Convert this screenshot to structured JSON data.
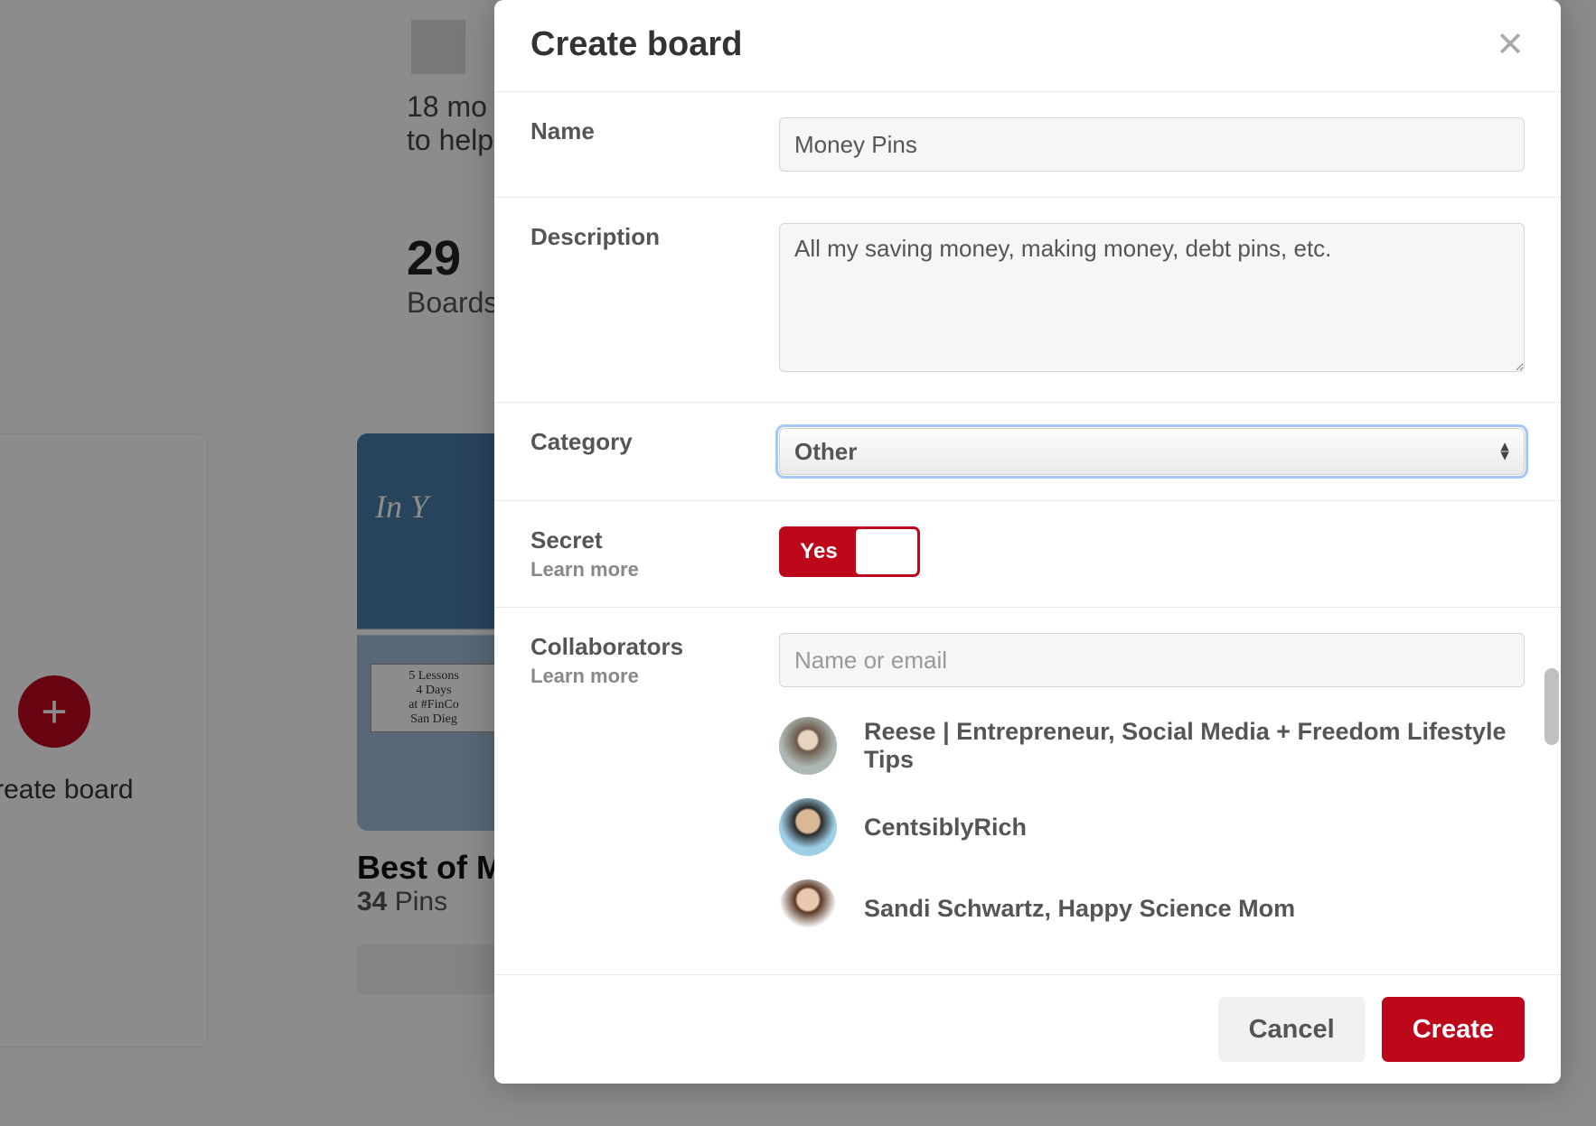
{
  "background": {
    "pencil_tip_text": "18 mo",
    "header_text": "to help",
    "stats_number": "29",
    "stats_label": "Boards",
    "create_board_label": "Create board",
    "board_title": "Best of M",
    "pins_count": "34",
    "pins_label": "Pins",
    "img_script_text": "In Y",
    "img_box_text_1": "5 Lessons",
    "img_box_text_2": "4 Days",
    "img_box_text_3": "at #FinCo",
    "img_box_text_4": "San Dieg"
  },
  "modal": {
    "title": "Create board",
    "name_label": "Name",
    "name_value": "Money Pins",
    "description_label": "Description",
    "description_value": "All my saving money, making money, debt pins, etc.",
    "category_label": "Category",
    "category_value": "Other",
    "secret_label": "Secret",
    "secret_learn_more": "Learn more",
    "secret_toggle_yes": "Yes",
    "collaborators_label": "Collaborators",
    "collaborators_learn_more": "Learn more",
    "collaborators_placeholder": "Name or email",
    "collaborator_suggestions": [
      "Reese | Entrepreneur, Social Media + Freedom Lifestyle Tips",
      "CentsiblyRich",
      "Sandi Schwartz, Happy Science Mom"
    ],
    "cancel_label": "Cancel",
    "create_label": "Create"
  }
}
